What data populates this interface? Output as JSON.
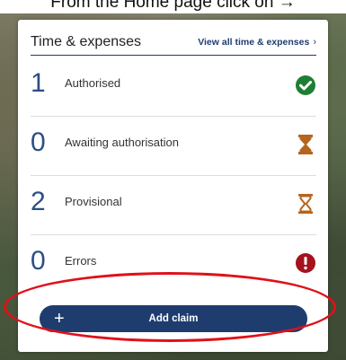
{
  "instruction": {
    "text": "From the Home page click on →"
  },
  "card": {
    "title": "Time & expenses",
    "link_label": "View all time & expenses",
    "link_chevron": "›",
    "rows": [
      {
        "count": "1",
        "label": "Authorised",
        "icon": "check-circle-icon",
        "icon_color": "#1e7e34"
      },
      {
        "count": "0",
        "label": "Awaiting authorisation",
        "icon": "hourglass-filled-icon",
        "icon_color": "#b5651d"
      },
      {
        "count": "2",
        "label": "Provisional",
        "icon": "hourglass-outline-icon",
        "icon_color": "#b5651d"
      },
      {
        "count": "0",
        "label": "Errors",
        "icon": "exclamation-circle-icon",
        "icon_color": "#a4121d"
      }
    ],
    "add_button": {
      "icon": "+",
      "label": "Add claim"
    }
  },
  "colors": {
    "primary": "#1f3c6e",
    "count_blue": "#2b4e86",
    "annotation_red": "#e0101a"
  }
}
